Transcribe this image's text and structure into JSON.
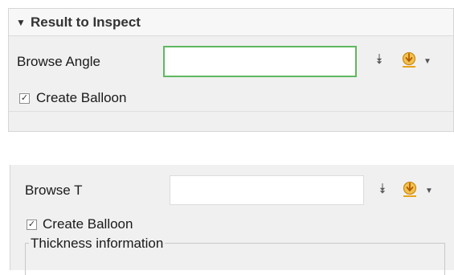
{
  "top_panel": {
    "header_title": "Result to Inspect",
    "field_label": "Browse Angle",
    "field_value": "",
    "checkbox_label": "Create Balloon",
    "checkbox_checked": true
  },
  "bottom_panel": {
    "field_label": "Browse T",
    "field_value": "",
    "checkbox_label": "Create Balloon",
    "checkbox_checked": true,
    "group_title": "Thickness information"
  },
  "colors": {
    "panel_bg": "#f0f0f0",
    "focus_border": "#5fb85f",
    "pick_icon": "#e8a317"
  },
  "icons": [
    "expand-down-icon",
    "pick-icon",
    "dropdown-arrow-icon",
    "collapse-triangle-icon",
    "checkmark-icon"
  ]
}
